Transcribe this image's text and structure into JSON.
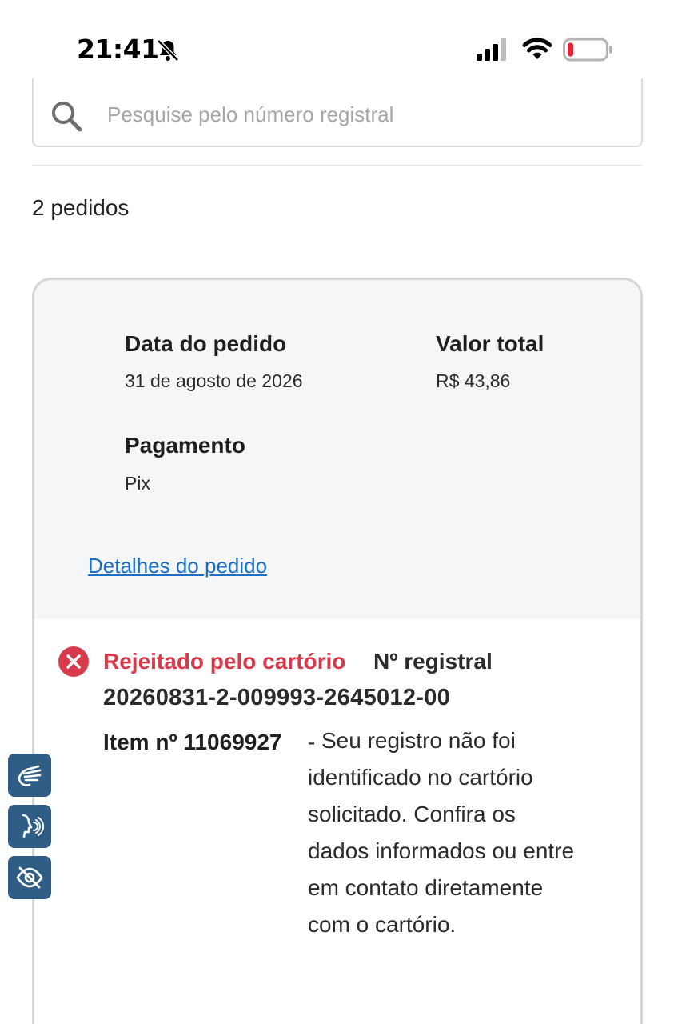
{
  "status_bar": {
    "time": "21:41",
    "icons": [
      "bell-muted-icon",
      "cellular-signal-icon",
      "wifi-icon",
      "battery-low-icon"
    ],
    "battery_color": "#e0283a"
  },
  "search": {
    "placeholder": "Pesquise pelo número registral",
    "value": ""
  },
  "orders_count": "2 pedidos",
  "order": {
    "date_label": "Data do pedido",
    "date_value": "31 de agosto de 2026",
    "total_label": "Valor total",
    "total_value": "R$ 43,86",
    "payment_label": "Pagamento",
    "payment_value": "Pix",
    "details_link": "Detalhes do pedido",
    "item": {
      "status": "Rejeitado pelo cartório",
      "status_color": "#d83a4b",
      "registry_label": "Nº registral",
      "registry_number": "20260831-2-009993-2645012-00",
      "item_label": "Item nº 11069927",
      "item_dash": "-",
      "message": "Seu registro não foi identificado no cartório solicitado. Confira os dados informados ou entre em contato diretamente com o cartório."
    }
  },
  "accessibility": {
    "buttons": [
      "sign-language-icon",
      "voice-reader-icon",
      "hide-eye-icon"
    ],
    "color": "#2f5d86"
  }
}
